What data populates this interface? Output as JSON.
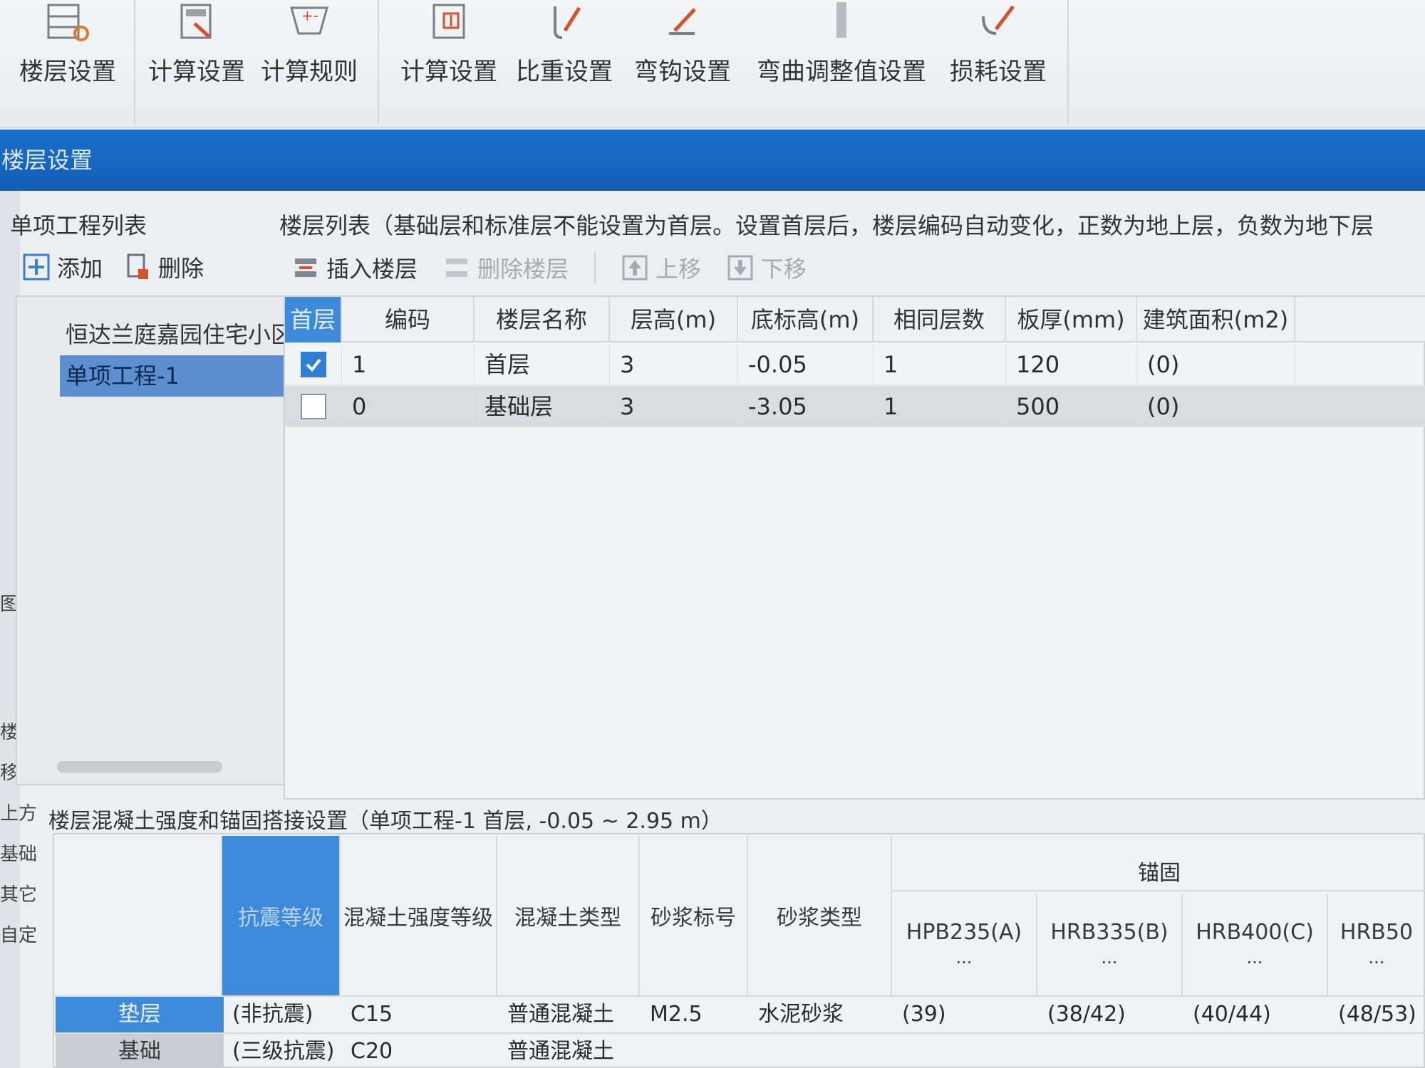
{
  "ribbon": {
    "buttons": [
      {
        "label": "楼层设置",
        "icon": "floor-settings-icon"
      },
      {
        "label": "计算设置",
        "icon": "calc-settings-icon"
      },
      {
        "label": "计算规则",
        "icon": "calc-rules-icon"
      },
      {
        "label": "计算设置",
        "icon": "rebar-calc-settings-icon"
      },
      {
        "label": "比重设置",
        "icon": "density-settings-icon"
      },
      {
        "label": "弯钩设置",
        "icon": "hook-settings-icon"
      },
      {
        "label": "弯曲调整值设置",
        "icon": "bend-adjust-icon"
      },
      {
        "label": "损耗设置",
        "icon": "loss-settings-icon"
      }
    ]
  },
  "dialog": {
    "title": "楼层设置"
  },
  "left_strip": [
    "图",
    "楼",
    "移",
    "上方",
    "基础",
    "其它",
    "自定"
  ],
  "project_list": {
    "title": "单项工程列表",
    "add_label": "添加",
    "delete_label": "删除",
    "items": [
      "恒达兰庭嘉园住宅小区",
      "单项工程-1"
    ]
  },
  "floor_list": {
    "title": "楼层列表（基础层和标准层不能设置为首层。设置首层后，楼层编码自动变化，正数为地上层，负数为地下层",
    "toolbar": {
      "insert_label": "插入楼层",
      "delete_label": "删除楼层",
      "up_label": "上移",
      "down_label": "下移"
    },
    "columns": [
      "首层",
      "编码",
      "楼层名称",
      "层高(m)",
      "底标高(m)",
      "相同层数",
      "板厚(mm)",
      "建筑面积(m2)"
    ],
    "rows": [
      {
        "first": true,
        "code": "1",
        "name": "首层",
        "height": "3",
        "base": "-0.05",
        "same": "1",
        "slab": "120",
        "area": "(0)"
      },
      {
        "first": false,
        "code": "0",
        "name": "基础层",
        "height": "3",
        "base": "-3.05",
        "same": "1",
        "slab": "500",
        "area": "(0)"
      }
    ]
  },
  "concrete": {
    "title": "楼层混凝土强度和锚固搭接设置（单项工程-1  首层, -0.05 ~ 2.95 m）",
    "columns": {
      "seismic": "抗震等级",
      "strength": "混凝土强度等级",
      "type": "混凝土类型",
      "mortar_grade": "砂浆标号",
      "mortar_type": "砂浆类型"
    },
    "anchor_title": "锚固",
    "rebar_cols": [
      "HPB235(A)",
      "HRB335(B)",
      "HRB400(C)",
      "HRB50"
    ],
    "dots": "...",
    "rows": [
      {
        "label": "垫层",
        "seismic": "(非抗震)",
        "strength": "C15",
        "type": "普通混凝土",
        "mortar_grade": "M2.5",
        "mortar_type": "水泥砂浆",
        "a": "(39)",
        "b": "(38/42)",
        "c": "(40/44)",
        "d": "(48/53)"
      },
      {
        "label": "基础",
        "seismic": "(三级抗震)",
        "strength": "C20",
        "type": "普通混凝土",
        "mortar_grade": "",
        "mortar_type": "",
        "a": "",
        "b": "",
        "c": "",
        "d": ""
      }
    ]
  }
}
